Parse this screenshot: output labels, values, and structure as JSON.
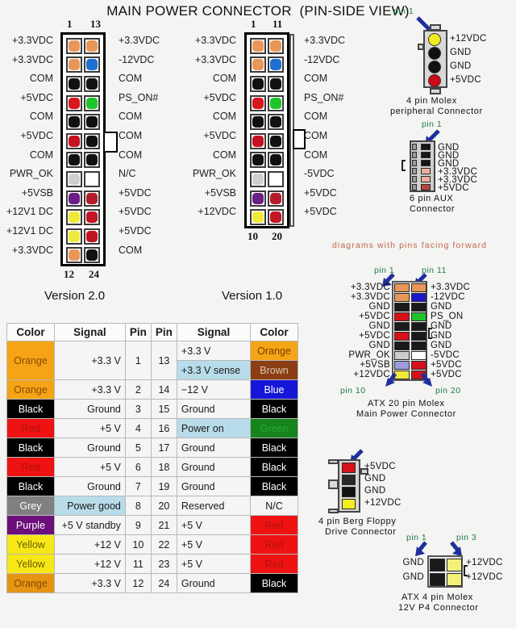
{
  "title": "MAIN POWER CONNECTOR  (PIN-SIDE VIEW)",
  "connector_v2": {
    "version_label": "Version 2.0",
    "top_left_num": "1",
    "top_right_num": "13",
    "bottom_left_num": "12",
    "bottom_right_num": "24",
    "rows": [
      {
        "left_label": "+3.3VDC",
        "left_color": "#e8975a",
        "right_color": "#e8975a",
        "right_label": "+3.3VDC"
      },
      {
        "left_label": "+3.3VDC",
        "left_color": "#e8975a",
        "right_color": "#1f6fd0",
        "right_label": "-12VDC"
      },
      {
        "left_label": "COM",
        "left_color": "#111111",
        "right_color": "#111111",
        "right_label": "COM"
      },
      {
        "left_label": "+5VDC",
        "left_color": "#d8161d",
        "right_color": "#1fc42a",
        "right_label": "PS_ON#"
      },
      {
        "left_label": "COM",
        "left_color": "#111111",
        "right_color": "#111111",
        "right_label": "COM"
      },
      {
        "left_label": "+5VDC",
        "left_color": "#c41020",
        "right_color": "#111111",
        "right_label": "COM"
      },
      {
        "left_label": "COM",
        "left_color": "#111111",
        "right_color": "#111111",
        "right_label": "COM"
      },
      {
        "left_label": "PWR_OK",
        "left_color": "#cfcfcf",
        "right_color": "#ffffff",
        "right_label": "N/C"
      },
      {
        "left_label": "+5VSB",
        "left_color": "#6b1e86",
        "right_color": "#b41c29",
        "right_label": "+5VDC"
      },
      {
        "left_label": "+12V1 DC",
        "left_color": "#efe93a",
        "right_color": "#c21524",
        "right_label": "+5VDC"
      },
      {
        "left_label": "+12V1 DC",
        "left_color": "#efe93a",
        "right_color": "#c21524",
        "right_label": "+5VDC"
      },
      {
        "left_label": "+3.3VDC",
        "left_color": "#e8975a",
        "right_color": "#111111",
        "right_label": "COM"
      }
    ]
  },
  "connector_v1": {
    "version_label": "Version 1.0",
    "top_left_num": "1",
    "top_right_num": "11",
    "bottom_left_num": "10",
    "bottom_right_num": "20",
    "rows": [
      {
        "left_label": "+3.3VDC",
        "left_color": "#e8975a",
        "right_color": "#e8975a",
        "right_label": "+3.3VDC"
      },
      {
        "left_label": "+3.3VDC",
        "left_color": "#e8975a",
        "right_color": "#1f6fd0",
        "right_label": "-12VDC"
      },
      {
        "left_label": "COM",
        "left_color": "#111111",
        "right_color": "#111111",
        "right_label": "COM"
      },
      {
        "left_label": "+5VDC",
        "left_color": "#d8161d",
        "right_color": "#1fc42a",
        "right_label": "PS_ON#"
      },
      {
        "left_label": "COM",
        "left_color": "#111111",
        "right_color": "#111111",
        "right_label": "COM"
      },
      {
        "left_label": "+5VDC",
        "left_color": "#c41020",
        "right_color": "#111111",
        "right_label": "COM"
      },
      {
        "left_label": "COM",
        "left_color": "#111111",
        "right_color": "#111111",
        "right_label": "COM"
      },
      {
        "left_label": "PWR_OK",
        "left_color": "#cfcfcf",
        "right_color": "#ffffff",
        "right_label": "-5VDC"
      },
      {
        "left_label": "+5VSB",
        "left_color": "#6b1e86",
        "right_color": "#b41c29",
        "right_label": "+5VDC"
      },
      {
        "left_label": "+12VDC",
        "left_color": "#efe93a",
        "right_color": "#c21524",
        "right_label": "+5VDC"
      }
    ]
  },
  "table": {
    "headers": [
      "Color",
      "Signal",
      "Pin",
      "Pin",
      "Signal",
      "Color"
    ],
    "rows": [
      {
        "lcolor_text": "Orange",
        "lcolor_bg": "#f5a416",
        "lcolor_fg": "#8a4b00",
        "lsignal": "+3.3 V",
        "lpin": "1",
        "rpin": "13",
        "rsignal": "+3.3 V",
        "rsignal_bg": "#f5f5f5",
        "rcolor_text": "Orange",
        "rcolor_bg": "#f5a416",
        "rcolor_fg": "#7a4200",
        "rsignal2": "+3.3 V sense",
        "rsignal2_bg": "#b8dcea",
        "rcolor2_text": "Brown",
        "rcolor2_bg": "#8b3d14",
        "rcolor2_fg": "#e0c9b6",
        "span": 2
      },
      {
        "lcolor_text": "Orange",
        "lcolor_bg": "#f5a416",
        "lcolor_fg": "#8a4b00",
        "lsignal": "+3.3 V",
        "lpin": "2",
        "rpin": "14",
        "rsignal": "−12 V",
        "rsignal_bg": "#f5f5f5",
        "rcolor_text": "Blue",
        "rcolor_bg": "#1616d8",
        "rcolor_fg": "#ffffff"
      },
      {
        "lcolor_text": "Black",
        "lcolor_bg": "#000000",
        "lcolor_fg": "#ffffff",
        "lsignal": "Ground",
        "lpin": "3",
        "rpin": "15",
        "rsignal": "Ground",
        "rsignal_bg": "#f5f5f5",
        "rcolor_text": "Black",
        "rcolor_bg": "#000000",
        "rcolor_fg": "#ffffff"
      },
      {
        "lcolor_text": "Red",
        "lcolor_bg": "#ef1212",
        "lcolor_fg": "#b01010",
        "lsignal": "+5 V",
        "lpin": "4",
        "rpin": "16",
        "rsignal": "Power on",
        "rsignal_bg": "#b8dcea",
        "rcolor_text": "Green",
        "rcolor_bg": "#15841c",
        "rcolor_fg": "#2aa832"
      },
      {
        "lcolor_text": "Black",
        "lcolor_bg": "#000000",
        "lcolor_fg": "#ffffff",
        "lsignal": "Ground",
        "lpin": "5",
        "rpin": "17",
        "rsignal": "Ground",
        "rsignal_bg": "#f5f5f5",
        "rcolor_text": "Black",
        "rcolor_bg": "#000000",
        "rcolor_fg": "#ffffff"
      },
      {
        "lcolor_text": "Red",
        "lcolor_bg": "#ef1212",
        "lcolor_fg": "#b01010",
        "lsignal": "+5 V",
        "lpin": "6",
        "rpin": "18",
        "rsignal": "Ground",
        "rsignal_bg": "#f5f5f5",
        "rcolor_text": "Black",
        "rcolor_bg": "#000000",
        "rcolor_fg": "#ffffff"
      },
      {
        "lcolor_text": "Black",
        "lcolor_bg": "#000000",
        "lcolor_fg": "#ffffff",
        "lsignal": "Ground",
        "lpin": "7",
        "rpin": "19",
        "rsignal": "Ground",
        "rsignal_bg": "#f5f5f5",
        "rcolor_text": "Black",
        "rcolor_bg": "#000000",
        "rcolor_fg": "#ffffff"
      },
      {
        "lcolor_text": "Grey",
        "lcolor_bg": "#808080",
        "lcolor_fg": "#ffffff",
        "lsignal": "Power good",
        "lsignal_bg": "#b8dcea",
        "lpin": "8",
        "rpin": "20",
        "rsignal": "Reserved",
        "rsignal_bg": "#f5f5f5",
        "rcolor_text": "N/C",
        "rcolor_bg": "#f5f5f5",
        "rcolor_fg": "#111111"
      },
      {
        "lcolor_text": "Purple",
        "lcolor_bg": "#6b0f7a",
        "lcolor_fg": "#ffffff",
        "lsignal": "+5 V standby",
        "lpin": "9",
        "rpin": "21",
        "rsignal": "+5 V",
        "rsignal_bg": "#f5f5f5",
        "rcolor_text": "Red",
        "rcolor_bg": "#ef1212",
        "rcolor_fg": "#b01010"
      },
      {
        "lcolor_text": "Yellow",
        "lcolor_bg": "#f7e718",
        "lcolor_fg": "#6b6000",
        "lsignal": "+12 V",
        "lpin": "10",
        "rpin": "22",
        "rsignal": "+5 V",
        "rsignal_bg": "#f5f5f5",
        "rcolor_text": "Red",
        "rcolor_bg": "#ef1212",
        "rcolor_fg": "#b01010"
      },
      {
        "lcolor_text": "Yellow",
        "lcolor_bg": "#f7e718",
        "lcolor_fg": "#6b6000",
        "lsignal": "+12 V",
        "lpin": "11",
        "rpin": "23",
        "rsignal": "+5 V",
        "rsignal_bg": "#f5f5f5",
        "rcolor_text": "Red",
        "rcolor_bg": "#ef1212",
        "rcolor_fg": "#b01010"
      },
      {
        "lcolor_text": "Orange",
        "lcolor_bg": "#e59413",
        "lcolor_fg": "#8a4b00",
        "lsignal": "+3.3 V",
        "lpin": "12",
        "rpin": "24",
        "rsignal": "Ground",
        "rsignal_bg": "#f5f5f5",
        "rcolor_text": "Black",
        "rcolor_bg": "#000000",
        "rcolor_fg": "#ffffff"
      }
    ]
  },
  "molex4": {
    "pin1_label": "pin 1",
    "caption_line1": "4 pin Molex",
    "caption_line2": "peripheral Connector",
    "pins": [
      {
        "label": "+12VDC",
        "color": "#f2ed1f"
      },
      {
        "label": "GND",
        "color": "#111111"
      },
      {
        "label": "GND",
        "color": "#111111"
      },
      {
        "label": "+5VDC",
        "color": "#cc0b14"
      }
    ]
  },
  "aux6": {
    "pin1_label": "pin 1",
    "caption_line1": "6 pin AUX",
    "caption_line2": "Connector",
    "pins": [
      {
        "label": "GND",
        "color": "#161616"
      },
      {
        "label": "GND",
        "color": "#161616"
      },
      {
        "label": "GND",
        "color": "#161616"
      },
      {
        "label": "+3.3VDC",
        "color": "#e8b09a"
      },
      {
        "label": "+3.3VDC",
        "color": "#e8b09a"
      },
      {
        "label": "+5VDC",
        "color": "#b5463c"
      }
    ]
  },
  "atx20": {
    "note": "diagrams with pins facing forward",
    "pin1_label": "pin 1",
    "pin11_label": "pin 11",
    "pin10_label": "pin 10",
    "pin20_label": "pin 20",
    "caption_line1": "ATX 20 pin Molex",
    "caption_line2": "Main Power Connector",
    "rows": [
      {
        "left_label": "+3.3VDC",
        "left_color": "#e8975a",
        "right_color": "#e8975a",
        "right_label": "+3.3VDC"
      },
      {
        "left_label": "+3.3VDC",
        "left_color": "#e8975a",
        "right_color": "#1a17c9",
        "right_label": "-12VDC"
      },
      {
        "left_label": "GND",
        "left_color": "#1a1a1a",
        "right_color": "#1a1a1a",
        "right_label": "GND"
      },
      {
        "left_label": "+5VDC",
        "left_color": "#d71119",
        "right_color": "#1fc42a",
        "right_label": "PS_ON"
      },
      {
        "left_label": "GND",
        "left_color": "#1a1a1a",
        "right_color": "#1a1a1a",
        "right_label": "GND"
      },
      {
        "left_label": "+5VDC",
        "left_color": "#d71119",
        "right_color": "#1a1a1a",
        "right_label": "GND"
      },
      {
        "left_label": "GND",
        "left_color": "#1a1a1a",
        "right_color": "#1a1a1a",
        "right_label": "GND"
      },
      {
        "left_label": "PWR_OK",
        "left_color": "#cccccc",
        "right_color": "#ffffff",
        "right_label": "-5VDC"
      },
      {
        "left_label": "+5VSB",
        "left_color": "#9d9ddd",
        "right_color": "#d71119",
        "right_label": "+5VDC"
      },
      {
        "left_label": "+12VDC",
        "left_color": "#efe93a",
        "right_color": "#d71119",
        "right_label": "+5VDC"
      }
    ]
  },
  "berg4": {
    "caption_line1": "4 pin Berg Floppy",
    "caption_line2": "Drive Connector",
    "pins": [
      {
        "label": "+5VDC",
        "color": "#d81219"
      },
      {
        "label": "GND",
        "color": "#2a2a2a"
      },
      {
        "label": "GND",
        "color": "#111111"
      },
      {
        "label": "+12VDC",
        "color": "#f2ed1f"
      }
    ]
  },
  "p4": {
    "pin1_label": "pin 1",
    "pin3_label": "pin 3",
    "caption_line1": "ATX 4 pin Molex",
    "caption_line2": "12V P4 Connector",
    "rows": [
      {
        "left_label": "GND",
        "left_color": "#1a1a1a",
        "right_color": "#f2f27a",
        "right_label": "+12VDC"
      },
      {
        "left_label": "GND",
        "left_color": "#1a1a1a",
        "right_color": "#f2f27a",
        "right_label": "+12VDC"
      }
    ]
  }
}
